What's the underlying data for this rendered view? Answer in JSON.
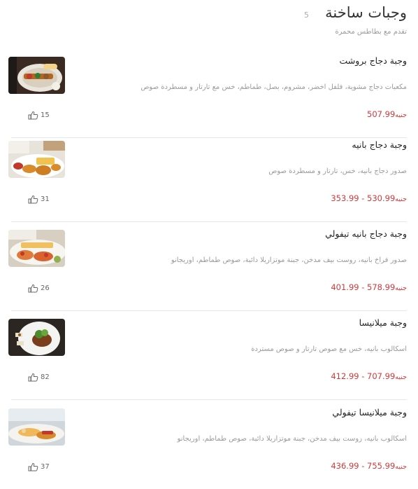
{
  "section": {
    "title": "وجبات ساخنة",
    "count": "5",
    "subtitle": "تقدم مع بطاطس محمرة"
  },
  "items": [
    {
      "name": "وجبة دجاج بروشت",
      "description": "مكعبات دجاج مشوية، فلفل اخضر، مشروم، بصل، طماطم، خس مع تارتار و مسطردة صوص",
      "price": "507.99",
      "currency": "جنيه",
      "likes": "15"
    },
    {
      "name": "وجبة دجاج بانيه",
      "description": "صدور دجاج بانيه، خس، تارتار و مسطردة صوص",
      "price": "353.99 - 530.99",
      "currency": "جنيه",
      "likes": "31"
    },
    {
      "name": "وجبة دجاج بانيه تيفولي",
      "description": "صدور فراخ بانيه، روست بيف مدخن، جبنة موتزاريلا دائبة، صوص طماطم، اوريجانو",
      "price": "401.99 - 578.99",
      "currency": "جنيه",
      "likes": "26"
    },
    {
      "name": "وجبة ميلانيسا",
      "description": "اسكالوب بانيه، خس مع صوص تارتار و صوص مستردة",
      "price": "412.99 - 707.99",
      "currency": "جنيه",
      "likes": "82"
    },
    {
      "name": "وجبة ميلانيسا تيفولي",
      "description": "اسكالوب بانيه، روست بيف مدخن، جبنة موتزاريلا دائبة، صوص طماطم، اوريجانو",
      "price": "436.99 - 755.99",
      "currency": "جنيه",
      "likes": "37"
    }
  ],
  "icons": {
    "like": "thumbs-up-icon"
  },
  "colors": {
    "price": "#d4373a",
    "divider": "#e6e6e6",
    "muted": "#9a9a9a"
  }
}
